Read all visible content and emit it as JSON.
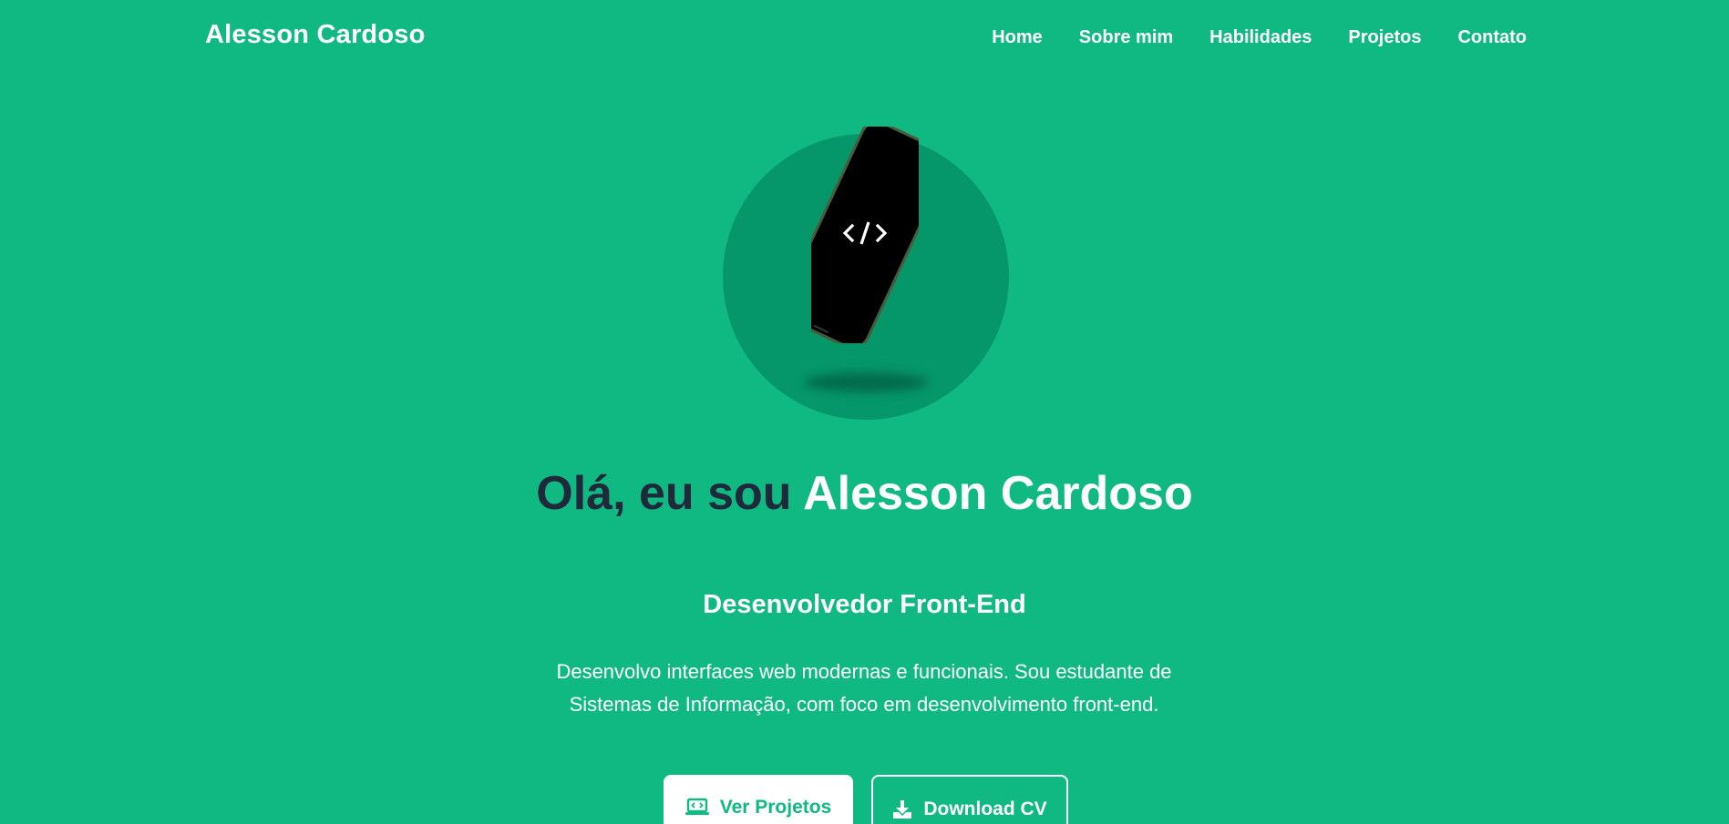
{
  "header": {
    "brand": "Alesson Cardoso",
    "nav": [
      "Home",
      "Sobre mim",
      "Habilidades",
      "Projetos",
      "Contato"
    ]
  },
  "hero": {
    "image_icon": "code-brackets-icon",
    "title_prefix": "Olá, eu sou",
    "title_name": "Alesson Cardoso",
    "subtitle": "Desenvolvedor Front-End",
    "description": "Desenvolvo interfaces web modernas e funcionais. Sou estudante de Sistemas de Informação, com foco em desenvolvimento front-end.",
    "buttons": {
      "primary": {
        "label": "Ver Projetos",
        "icon": "laptop-code-icon"
      },
      "secondary": {
        "label": "Download CV",
        "icon": "download-icon"
      }
    }
  },
  "colors": {
    "background": "#10b981",
    "circle": "#059669",
    "title_dark": "#1e293b",
    "white": "#ffffff"
  }
}
